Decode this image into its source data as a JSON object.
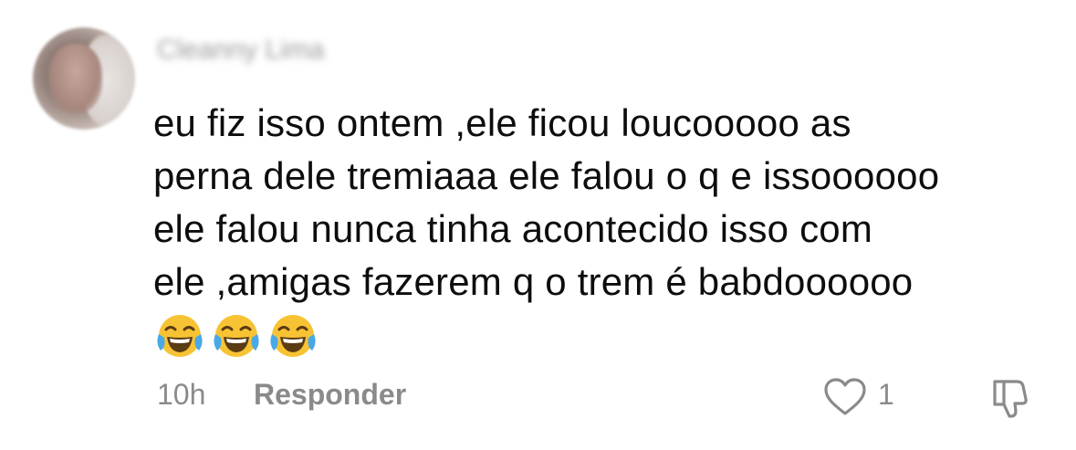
{
  "comment": {
    "username": "Cleanny Lima",
    "text_lines": [
      "eu fiz isso ontem ,ele ficou loucooooo as",
      "perna dele tremiaaa ele falou o q e issoooooo",
      "ele falou nunca tinha acontecido isso com",
      "ele ,amigas fazerem q o trem é babdoooooo"
    ],
    "emojis": [
      "😂",
      "😂",
      "😂"
    ],
    "emoji_icon": "face-with-tears-of-joy-icon",
    "timestamp": "10h",
    "reply_label": "Responder",
    "like_count": "1",
    "like_icon": "heart-icon",
    "dislike_icon": "thumbs-down-icon",
    "colors": {
      "text": "#0d0d0d",
      "muted": "#8a8a8a",
      "emoji_face": "#f7c334",
      "emoji_tears": "#4aa8e6"
    }
  }
}
